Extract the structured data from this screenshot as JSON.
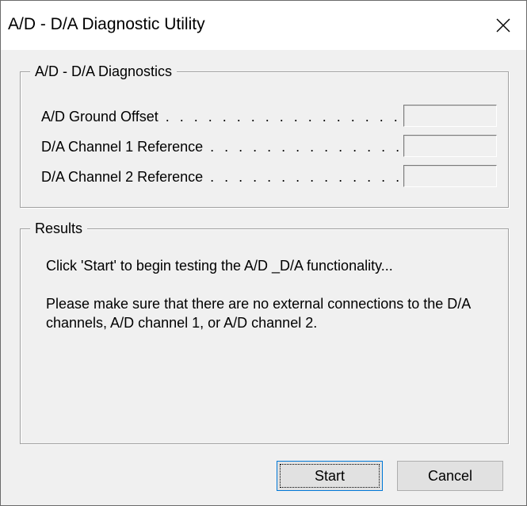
{
  "window": {
    "title": "A/D - D/A Diagnostic Utility",
    "close_icon": "close-icon"
  },
  "diagnostics": {
    "group_label": "A/D - D/A Diagnostics",
    "rows": [
      {
        "label": "A/D Ground Offset",
        "dots": " . . . . . . . . . . . . . . . . . . . .",
        "value": ""
      },
      {
        "label": "D/A Channel 1 Reference",
        "dots": " . . . . . . . . . . . . . .",
        "value": ""
      },
      {
        "label": "D/A Channel 2 Reference",
        "dots": " . . . . . . . . . . . . . . .",
        "value": ""
      }
    ]
  },
  "results": {
    "group_label": "Results",
    "line1": "Click 'Start' to begin testing the A/D _D/A functionality...",
    "line2": "Please make sure that there are no external connections to the D/A channels, A/D channel 1, or A/D channel 2."
  },
  "buttons": {
    "start_label": "Start",
    "cancel_label": "Cancel"
  }
}
